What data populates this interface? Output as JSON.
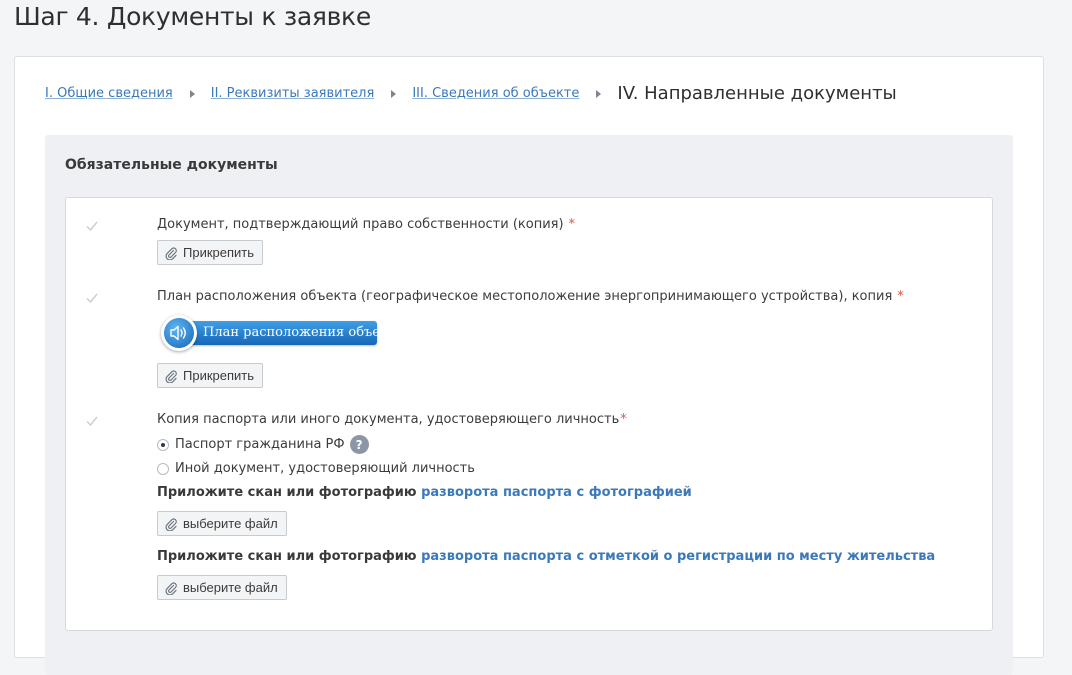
{
  "page": {
    "title": "Шаг 4. Документы к заявке"
  },
  "breadcrumb": {
    "items": [
      "I. Общие сведения",
      "II. Реквизиты заявителя",
      "III. Сведения об объекте"
    ],
    "current": "IV. Направленные документы"
  },
  "section": {
    "title": "Обязательные документы"
  },
  "documents": {
    "ownership": {
      "label": "Документ, подтверждающий право собственности (копия)",
      "required_mark": "*",
      "attach_label": "Прикрепить"
    },
    "location_plan": {
      "label": "План расположения объекта (географическое местоположение энергопринимающего устройства), копия",
      "required_mark": "*",
      "audio_label": "План расположения объекта",
      "attach_label": "Прикрепить"
    },
    "passport": {
      "label": "Копия паспорта или иного документа, удостоверяющего личность",
      "required_mark": "*",
      "options": [
        {
          "label": "Паспорт гражданина РФ",
          "selected": true
        },
        {
          "label": "Иной документ, удостоверяющий личность",
          "selected": false
        }
      ],
      "help_glyph": "?",
      "hint1_prefix": "Приложите скан или фотографию",
      "hint1_link": "разворота паспорта с фотографией",
      "hint2_prefix": "Приложите скан или фотографию",
      "hint2_link": "разворота паспорта с отметкой о регистрации по месту жительства",
      "file_button_label": "выберите файл"
    }
  },
  "colors": {
    "link": "#3b79b8",
    "required": "#e2543f",
    "audio_bar": "#1b74c6"
  },
  "icons": {
    "check": "check-icon",
    "clip": "paperclip-icon",
    "audio": "speaker-icon",
    "help": "question-icon",
    "breadcrumb_separator": "caret-right-icon"
  }
}
